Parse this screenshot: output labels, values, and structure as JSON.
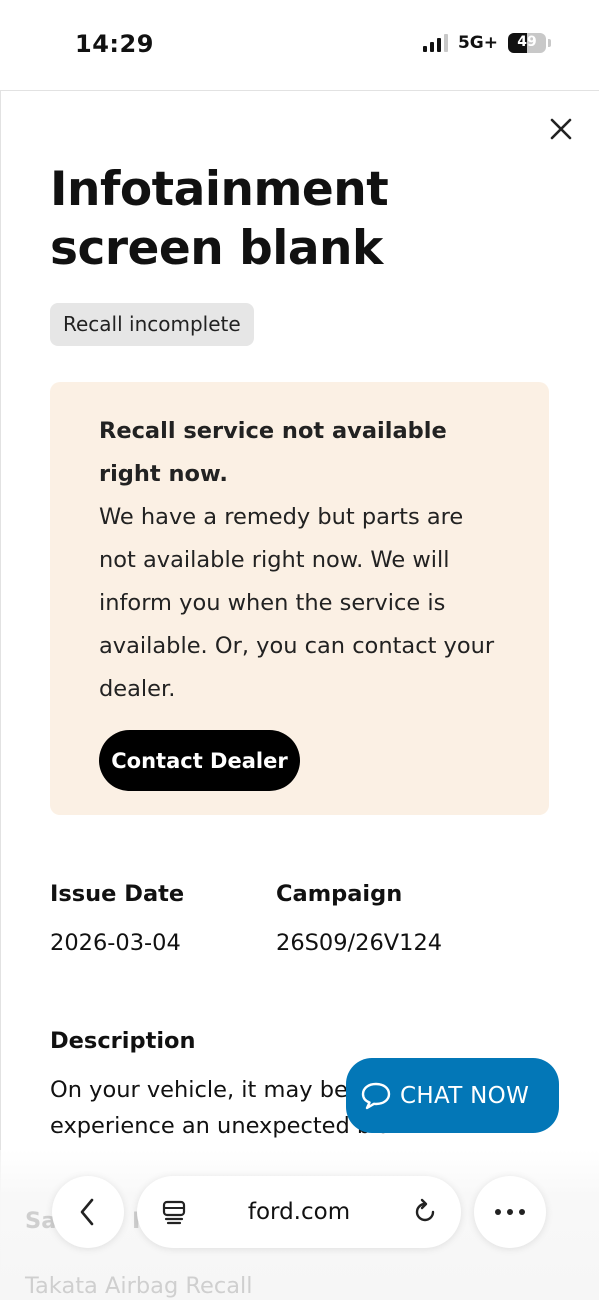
{
  "status_bar": {
    "time": "14:29",
    "network": "5G+",
    "battery": "49",
    "battery_level_percent": 49
  },
  "modal": {
    "close_icon": "close-icon",
    "title": "Infotainment screen blank",
    "status_badge": "Recall incomplete",
    "notice": {
      "title": "Recall service not available right now.",
      "body": "We have a remedy but parts are not available right now. We will inform you when the service is available. Or, you can contact your dealer.",
      "button_label": "Contact Dealer",
      "background_color": "#fbf0e4"
    },
    "details": {
      "issue_date_label": "Issue Date",
      "issue_date_value": "2026-03-04",
      "campaign_label": "Campaign",
      "campaign_value": "26S09/26V124"
    },
    "description": {
      "label": "Description",
      "text": "On your vehicle, it may be possible to experience an unexpected blank"
    },
    "next_section": {
      "heading_start": "Sa",
      "heading_end": "R",
      "subtext": "Takata Airbag Recall"
    }
  },
  "chat": {
    "label": "CHAT NOW",
    "icon": "chat-bubble-icon",
    "color": "#0377b7"
  },
  "browser_toolbar": {
    "back_icon": "chevron-left-icon",
    "tabs_icon": "tabs-icon",
    "url": "ford.com",
    "reload_icon": "reload-icon",
    "more_icon": "more-horizontal-icon"
  }
}
